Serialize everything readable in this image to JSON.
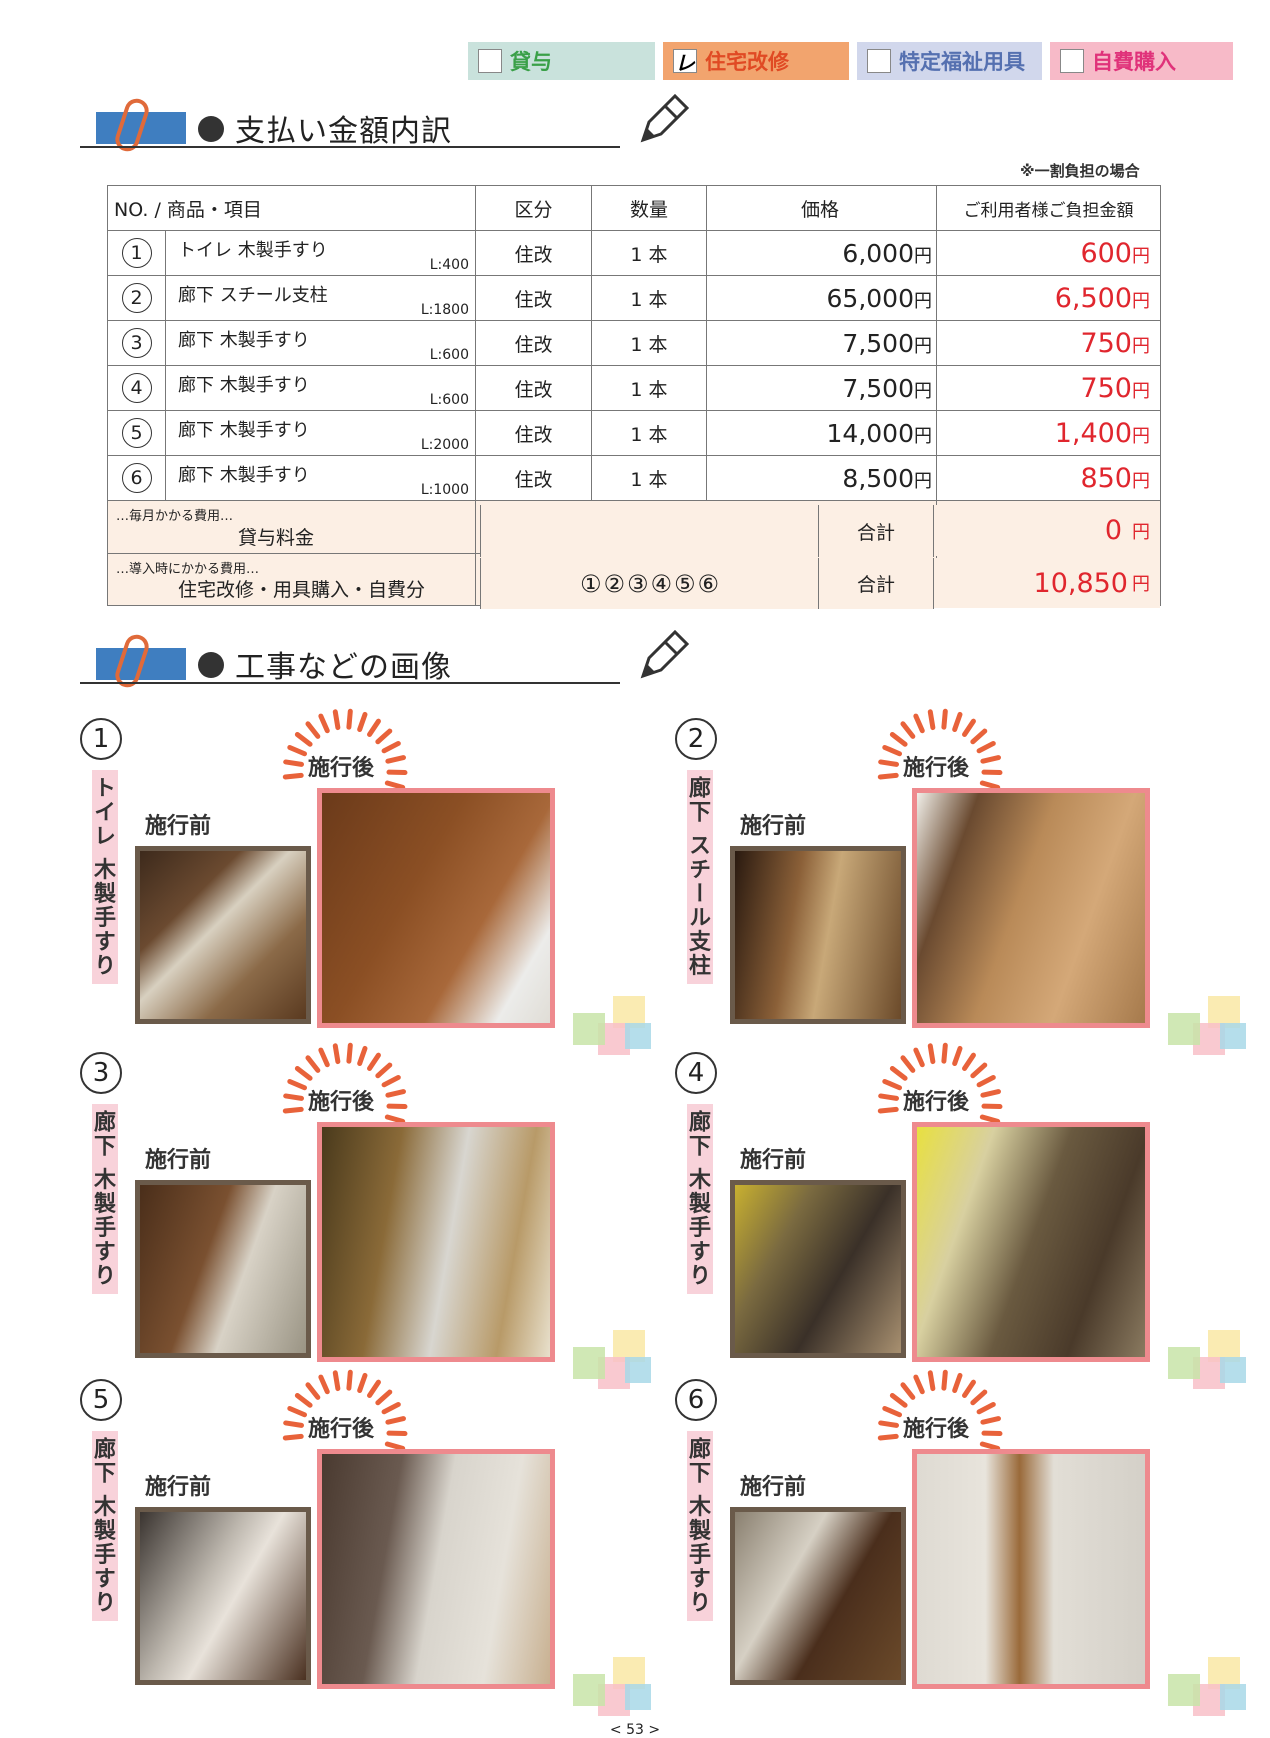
{
  "tabs": [
    {
      "label": "貸与",
      "checked": "",
      "color": "#3aa048"
    },
    {
      "label": "住宅改修",
      "checked": "レ",
      "color": "#e04a24"
    },
    {
      "label": "特定福祉用具",
      "checked": "",
      "color": "#5570b0"
    },
    {
      "label": "自費購入",
      "checked": "",
      "color": "#e0327a"
    }
  ],
  "sections": {
    "payment_title": "支払い金額内訳",
    "photos_title": "工事などの画像"
  },
  "note": "※一割負担の場合",
  "table": {
    "headers": {
      "item": "NO. / 商品・項目",
      "kubun": "区分",
      "qty": "数量",
      "price": "価格",
      "user": "ご利用者様ご負担金額"
    },
    "rows": [
      {
        "no": "1",
        "name": "トイレ 木製手すり",
        "length": "L:400",
        "kubun": "住改",
        "qty": "1 本",
        "price": "6,000",
        "user": "600"
      },
      {
        "no": "2",
        "name": "廊下 スチール支柱",
        "length": "L:1800",
        "kubun": "住改",
        "qty": "1 本",
        "price": "65,000",
        "user": "6,500"
      },
      {
        "no": "3",
        "name": "廊下 木製手すり",
        "length": "L:600",
        "kubun": "住改",
        "qty": "1 本",
        "price": "7,500",
        "user": "750"
      },
      {
        "no": "4",
        "name": "廊下 木製手すり",
        "length": "L:600",
        "kubun": "住改",
        "qty": "1 本",
        "price": "7,500",
        "user": "750"
      },
      {
        "no": "5",
        "name": "廊下 木製手すり",
        "length": "L:2000",
        "kubun": "住改",
        "qty": "1 本",
        "price": "14,000",
        "user": "1,400"
      },
      {
        "no": "6",
        "name": "廊下 木製手すり",
        "length": "L:1000",
        "kubun": "住改",
        "qty": "1 本",
        "price": "8,500",
        "user": "850"
      }
    ],
    "yen": "円",
    "monthly": {
      "small": "…毎月かかる費用…",
      "label": "貸与料金",
      "total_label": "合計",
      "total": "0"
    },
    "initial": {
      "small": "…導入時にかかる費用…",
      "label": "住宅改修・用具購入・自費分",
      "items": "①②③④⑤⑥",
      "total_label": "合計",
      "total": "10,850"
    }
  },
  "photos": [
    {
      "no": "1",
      "label": "トイレ 木製手すり",
      "before": "施行前",
      "after": "施行後"
    },
    {
      "no": "2",
      "label": "廊下 スチール支柱",
      "before": "施行前",
      "after": "施行後"
    },
    {
      "no": "3",
      "label": "廊下 木製手すり",
      "before": "施行前",
      "after": "施行後"
    },
    {
      "no": "4",
      "label": "廊下 木製手すり",
      "before": "施行前",
      "after": "施行後"
    },
    {
      "no": "5",
      "label": "廊下 木製手すり",
      "before": "施行前",
      "after": "施行後"
    },
    {
      "no": "6",
      "label": "廊下 木製手すり",
      "before": "施行前",
      "after": "施行後"
    }
  ],
  "page_number": "< 53 >"
}
